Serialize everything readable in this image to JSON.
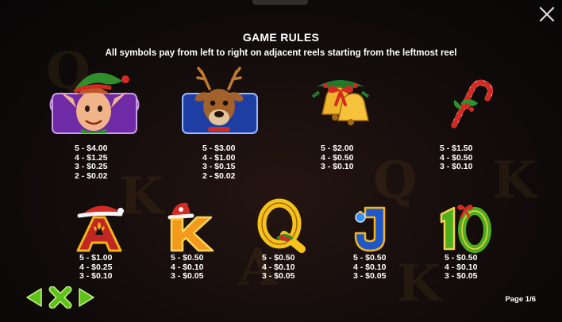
{
  "header": {
    "title": "GAME RULES",
    "subtitle": "All symbols pay from left to right on adjacent reels starting from the leftmost reel"
  },
  "symbols": [
    {
      "name": "elf",
      "pays": [
        "5 - $4.00",
        "4 - $1.25",
        "3 - $0.25",
        "2 - $0.02"
      ]
    },
    {
      "name": "reindeer",
      "pays": [
        "5 - $3.00",
        "4 - $1.00",
        "3 - $0.15",
        "2 - $0.02"
      ]
    },
    {
      "name": "bells",
      "pays": [
        "5 - $2.00",
        "4 - $0.50",
        "3 - $0.10"
      ]
    },
    {
      "name": "candy-cane",
      "pays": [
        "5 - $1.50",
        "4 - $0.50",
        "3 - $0.10"
      ]
    },
    {
      "name": "ace",
      "pays": [
        "5 - $1.00",
        "4 - $0.25",
        "3 - $0.10"
      ]
    },
    {
      "name": "king",
      "pays": [
        "5 - $0.50",
        "4 - $0.10",
        "3 - $0.05"
      ]
    },
    {
      "name": "queen",
      "pays": [
        "5 - $0.50",
        "4 - $0.10",
        "3 - $0.05"
      ]
    },
    {
      "name": "jack",
      "pays": [
        "5 - $0.50",
        "4 - $0.10",
        "3 - $0.05"
      ]
    },
    {
      "name": "ten",
      "pays": [
        "5 - $0.50",
        "4 - $0.10",
        "3 - $0.05"
      ]
    }
  ],
  "card_letters": {
    "ace": "A",
    "king": "K",
    "queen": "Q",
    "jack": "J",
    "ten": "10"
  },
  "page_indicator": "Page 1/6",
  "icons": {
    "close": "close-icon",
    "prev": "arrow-left-icon",
    "exit": "x-icon",
    "next": "arrow-right-icon"
  },
  "colors": {
    "nav_green": "#5fc21a",
    "gold": "#f4b41a",
    "background": "#0b0a0a"
  }
}
